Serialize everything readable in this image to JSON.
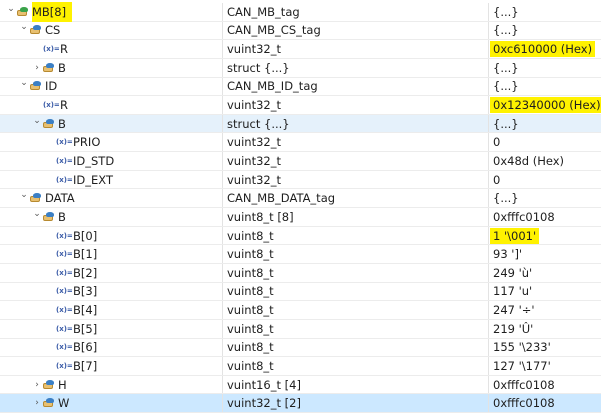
{
  "rows": [
    {
      "name": "MB[8]",
      "type": "CAN_MB_tag",
      "value": "{...}",
      "level": 0,
      "exp": "open",
      "icon": "struct-green",
      "hlname": true
    },
    {
      "name": "CS",
      "type": "CAN_MB_CS_tag",
      "value": "{...}",
      "level": 1,
      "exp": "open",
      "icon": "struct"
    },
    {
      "name": "R",
      "type": "vuint32_t",
      "value": "0xc610000 (Hex)",
      "level": 2,
      "exp": "none",
      "icon": "var",
      "hl": true
    },
    {
      "name": "B",
      "type": "struct {...}",
      "value": "{...}",
      "level": 2,
      "exp": "closed",
      "icon": "struct"
    },
    {
      "name": "ID",
      "type": "CAN_MB_ID_tag",
      "value": "{...}",
      "level": 1,
      "exp": "open",
      "icon": "struct"
    },
    {
      "name": "R",
      "type": "vuint32_t",
      "value": "0x12340000 (Hex)",
      "level": 2,
      "exp": "none",
      "icon": "var",
      "hl": true
    },
    {
      "name": "B",
      "type": "struct {...}",
      "value": "{...}",
      "level": 2,
      "exp": "open",
      "icon": "struct",
      "sel": true
    },
    {
      "name": "PRIO",
      "type": "vuint32_t",
      "value": "0",
      "level": 3,
      "exp": "none",
      "icon": "var"
    },
    {
      "name": "ID_STD",
      "type": "vuint32_t",
      "value": "0x48d (Hex)",
      "level": 3,
      "exp": "none",
      "icon": "var"
    },
    {
      "name": "ID_EXT",
      "type": "vuint32_t",
      "value": "0",
      "level": 3,
      "exp": "none",
      "icon": "var"
    },
    {
      "name": "DATA",
      "type": "CAN_MB_DATA_tag",
      "value": "{...}",
      "level": 1,
      "exp": "open",
      "icon": "struct"
    },
    {
      "name": "B",
      "type": "vuint8_t [8]",
      "value": "0xfffc0108",
      "level": 2,
      "exp": "open",
      "icon": "struct"
    },
    {
      "name": "B[0]",
      "type": "vuint8_t",
      "value": "1 '\\001'",
      "level": 3,
      "exp": "none",
      "icon": "var",
      "hl": true
    },
    {
      "name": "B[1]",
      "type": "vuint8_t",
      "value": "93 ']'",
      "level": 3,
      "exp": "none",
      "icon": "var"
    },
    {
      "name": "B[2]",
      "type": "vuint8_t",
      "value": "249 'ù'",
      "level": 3,
      "exp": "none",
      "icon": "var"
    },
    {
      "name": "B[3]",
      "type": "vuint8_t",
      "value": "117 'u'",
      "level": 3,
      "exp": "none",
      "icon": "var"
    },
    {
      "name": "B[4]",
      "type": "vuint8_t",
      "value": "247 '÷'",
      "level": 3,
      "exp": "none",
      "icon": "var"
    },
    {
      "name": "B[5]",
      "type": "vuint8_t",
      "value": "219 'Û'",
      "level": 3,
      "exp": "none",
      "icon": "var"
    },
    {
      "name": "B[6]",
      "type": "vuint8_t",
      "value": "155 '\\233'",
      "level": 3,
      "exp": "none",
      "icon": "var"
    },
    {
      "name": "B[7]",
      "type": "vuint8_t",
      "value": "127 '\\177'",
      "level": 3,
      "exp": "none",
      "icon": "var"
    },
    {
      "name": "H",
      "type": "vuint16_t [4]",
      "value": "0xfffc0108",
      "level": 2,
      "exp": "closed",
      "icon": "struct"
    },
    {
      "name": "W",
      "type": "vuint32_t [2]",
      "value": "0xfffc0108",
      "level": 2,
      "exp": "closed",
      "icon": "struct",
      "focus": true
    }
  ]
}
